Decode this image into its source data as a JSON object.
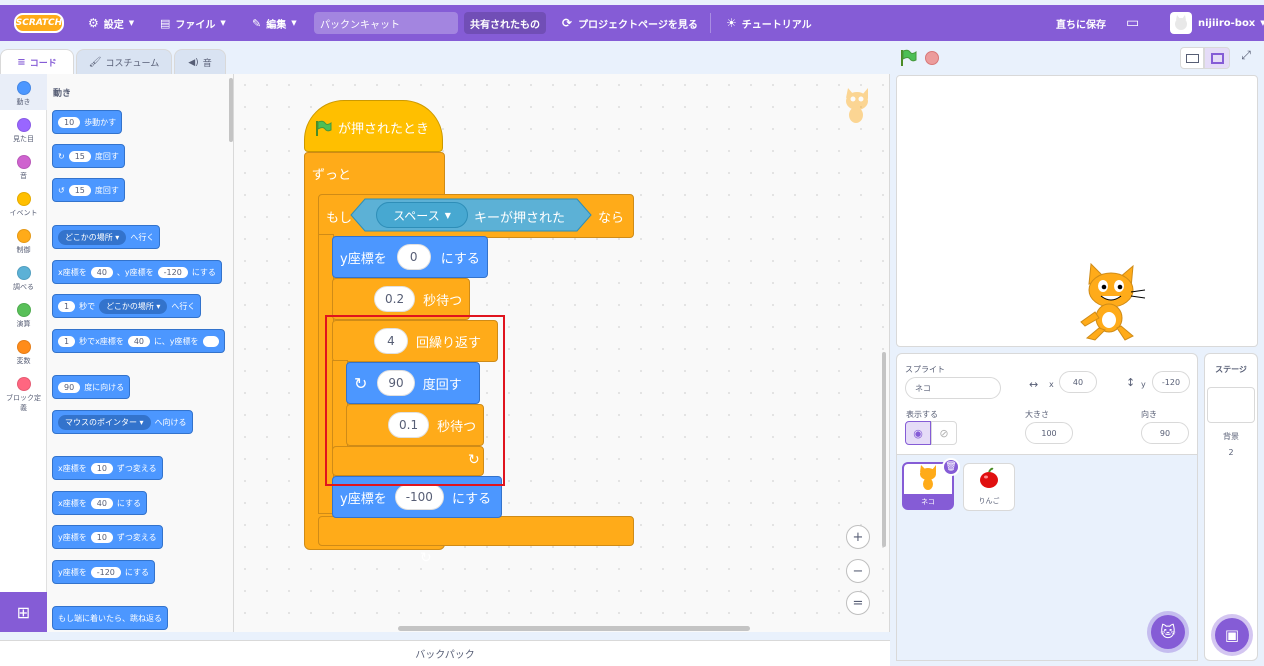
{
  "menu": {
    "logo": "SCRATCH",
    "settings": "設定",
    "file": "ファイル",
    "edit": "編集",
    "project_title": "パックンキャット",
    "shared": "共有されたもの",
    "project_page": "プロジェクトページを見る",
    "tutorial": "チュートリアル",
    "save_now": "直ちに保存",
    "username": "nijiiro-box"
  },
  "tabs": {
    "code": "コード",
    "costume": "コスチューム",
    "sound": "音"
  },
  "categories": [
    {
      "label": "動き",
      "color": "#4c97ff"
    },
    {
      "label": "見た目",
      "color": "#9966ff"
    },
    {
      "label": "音",
      "color": "#cf63cf"
    },
    {
      "label": "イベント",
      "color": "#ffbf00"
    },
    {
      "label": "制御",
      "color": "#ffab19"
    },
    {
      "label": "調べる",
      "color": "#5cb1d6"
    },
    {
      "label": "演算",
      "color": "#59c059"
    },
    {
      "label": "変数",
      "color": "#ff8c1a"
    },
    {
      "label": "ブロック定義",
      "color": "#ff6680"
    }
  ],
  "palette": {
    "heading": "動き",
    "move": {
      "n": "10",
      "t": "歩動かす"
    },
    "turn_right": {
      "n": "15",
      "t": "度回す"
    },
    "turn_left": {
      "n": "15",
      "t": "度回す"
    },
    "goto": {
      "dd": "どこかの場所",
      "t": "へ行く"
    },
    "gotoxy": {
      "a": "x座標を",
      "x": "40",
      "b": "、y座標を",
      "y": "-120",
      "c": "にする"
    },
    "glide": {
      "n": "1",
      "a": "秒で",
      "dd": "どこかの場所",
      "t": "へ行く"
    },
    "glidexy": {
      "n": "1",
      "a": "秒でx座標を",
      "x": "40",
      "b": "に、y座標を"
    },
    "point": {
      "n": "90",
      "t": "度に向ける"
    },
    "pointto": {
      "dd": "マウスのポインター",
      "t": "へ向ける"
    },
    "changex": {
      "a": "x座標を",
      "n": "10",
      "t": "ずつ変える"
    },
    "setx": {
      "a": "x座標を",
      "n": "40",
      "t": "にする"
    },
    "changey": {
      "a": "y座標を",
      "n": "10",
      "t": "ずつ変える"
    },
    "sety": {
      "a": "y座標を",
      "n": "-120",
      "t": "にする"
    },
    "bounce": "もし端に着いたら、跳ね返る"
  },
  "script": {
    "hat": "が押されたとき",
    "forever": "ずっと",
    "if_label": "もし",
    "key_dd": "スペース",
    "key_text": "キーが押された",
    "then": "なら",
    "sety1": {
      "a": "y座標を",
      "n": "0",
      "b": "にする"
    },
    "wait1": {
      "n": "0.2",
      "t": "秒待つ"
    },
    "repeat": {
      "n": "4",
      "t": "回繰り返す"
    },
    "turn": {
      "n": "90",
      "t": "度回す"
    },
    "wait2": {
      "n": "0.1",
      "t": "秒待つ"
    },
    "sety2": {
      "a": "y座標を",
      "n": "-100",
      "b": "にする"
    }
  },
  "zoom": {
    "in": "+",
    "out": "−",
    "reset": "="
  },
  "backpack": "バックパック",
  "sprite_info": {
    "label": "スプライト",
    "name": "ネコ",
    "x_label": "x",
    "x": "40",
    "y_label": "y",
    "y": "-120",
    "show_label": "表示する",
    "size_label": "大きさ",
    "size": "100",
    "direction_label": "向き",
    "direction": "90"
  },
  "sprites": [
    {
      "name": "ネコ"
    },
    {
      "name": "りんご"
    }
  ],
  "stage_pane": {
    "label": "ステージ",
    "backdrop_label": "背景",
    "backdrop_count": "2"
  }
}
